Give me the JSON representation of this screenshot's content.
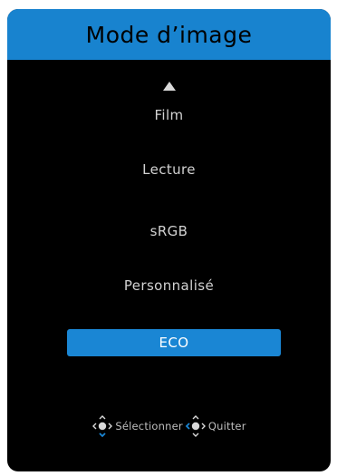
{
  "header": {
    "title": "Mode d’image"
  },
  "menu": {
    "items": [
      {
        "label": "Film",
        "selected": false
      },
      {
        "label": "Lecture",
        "selected": false
      },
      {
        "label": "sRGB",
        "selected": false
      },
      {
        "label": "Personnalisé",
        "selected": false
      },
      {
        "label": "ECO",
        "selected": true
      }
    ]
  },
  "footer": {
    "select_label": "Sélectionner",
    "exit_label": "Quitter"
  },
  "icons": {
    "scroll": "triangle-up-icon",
    "select": "joystick-select-icon",
    "exit": "joystick-exit-icon"
  },
  "colors": {
    "accent": "#1883cf",
    "selected_bg": "#1a86d4",
    "text": "#d2d2d2",
    "background": "#000000"
  }
}
